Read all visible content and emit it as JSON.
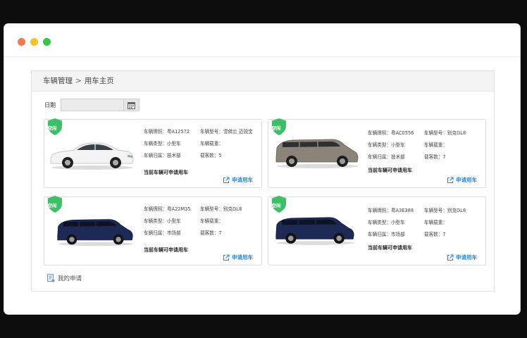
{
  "breadcrumb": {
    "root": "车辆管理",
    "separator": ">",
    "current": "用车主页"
  },
  "filter": {
    "date_label": "日期",
    "date_value": ""
  },
  "colors": {
    "accent": "#2f86d6",
    "badge": "#3dbf68"
  },
  "cars": [
    {
      "status_badge": "空闲",
      "image_icon": "white-sedan",
      "plate": "车辆牌照：粤A12572",
      "model": "车辆型号：雪佛兰 迈锐宝",
      "type": "车辆类型：小型车",
      "load": "车辆载重：",
      "dept": "车辆归属：技术部",
      "seats": "载客数：5",
      "status_text": "当前车辆可申请用车",
      "apply_label": "申请用车"
    },
    {
      "status_badge": "空闲",
      "image_icon": "gray-mpv",
      "plate": "车辆牌照：粤AC0556",
      "model": "车辆型号：别克GL8",
      "type": "车辆类型：小型车",
      "load": "车辆载重：",
      "dept": "车辆归属：技术部",
      "seats": "载客数：7",
      "status_text": "当前车辆可申请用车",
      "apply_label": "申请用车"
    },
    {
      "status_badge": "空闲",
      "image_icon": "navy-mpv",
      "plate": "车辆牌照：粤A22M35",
      "model": "车辆型号：别克GL8",
      "type": "车辆类型：小型车",
      "load": "车辆载重：",
      "dept": "车辆归属：市场部",
      "seats": "载客数：7",
      "status_text": "当前车辆可申请用车",
      "apply_label": "申请用车"
    },
    {
      "status_badge": "空闲",
      "image_icon": "navy-mpv",
      "plate": "车辆牌照：粤A3E388",
      "model": "车辆型号：别克GL8",
      "type": "车辆类型：小型车",
      "load": "车辆载重：",
      "dept": "车辆归属：市场部",
      "seats": "载客数：7",
      "status_text": "当前车辆可申请用车",
      "apply_label": "申请用车"
    }
  ],
  "footer": {
    "my_applications": "我的申请"
  }
}
